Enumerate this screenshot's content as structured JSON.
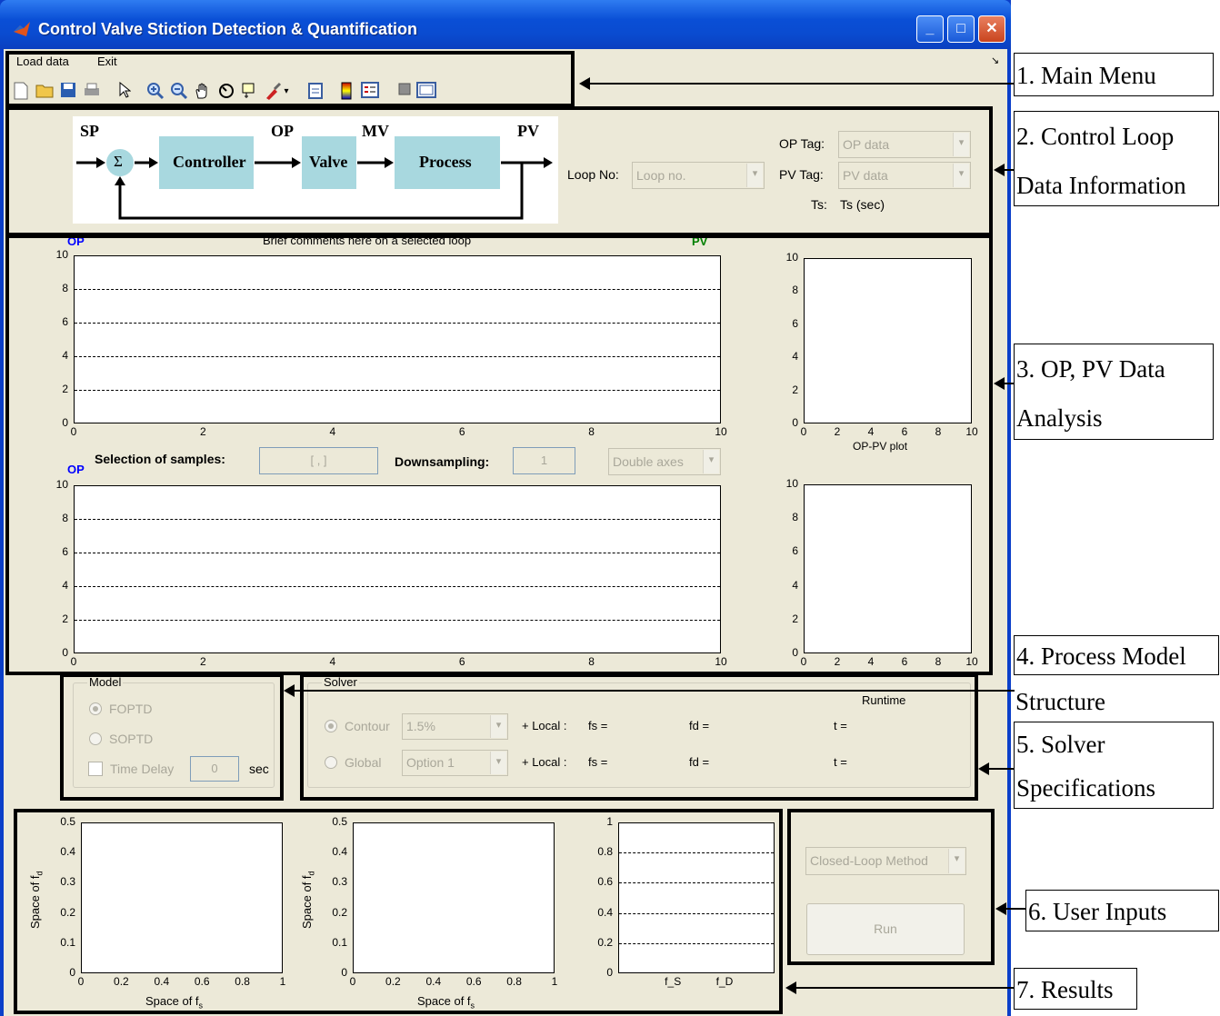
{
  "window": {
    "title": "Control Valve Stiction Detection & Quantification",
    "minimize": "_",
    "maximize": "□",
    "close": "✕"
  },
  "menu": {
    "load_data": "Load data",
    "exit": "Exit",
    "corner": "↘"
  },
  "diagram": {
    "sp": "SP",
    "op": "OP",
    "mv": "MV",
    "pv": "PV",
    "sum": "Σ",
    "controller": "Controller",
    "valve": "Valve",
    "process": "Process"
  },
  "loop_info": {
    "loop_no_label": "Loop No:",
    "loop_no_placeholder": "Loop no.",
    "op_tag_label": "OP Tag:",
    "op_tag_value": "OP data",
    "pv_tag_label": "PV Tag:",
    "pv_tag_value": "PV data",
    "ts_label": "Ts:",
    "ts_value": "Ts (sec)"
  },
  "analysis": {
    "comment": "Brief comments here on a selected loop",
    "top_left_label": "OP",
    "top_right_label": "PV",
    "mid_label": "OP",
    "selection_label": "Selection of samples:",
    "selection_value": "[ , ]",
    "downsampling_label": "Downsampling:",
    "downsampling_value": "1",
    "axes_mode": "Double axes",
    "oppv_xlabel": "OP-PV plot",
    "x_ticks": [
      "0",
      "2",
      "4",
      "6",
      "8",
      "10"
    ],
    "y_ticks": [
      "10",
      "8",
      "6",
      "4",
      "2",
      "0"
    ]
  },
  "model": {
    "title": "Model",
    "foptd": "FOPTD",
    "soptd": "SOPTD",
    "time_delay": "Time Delay",
    "time_delay_value": "0",
    "unit": "sec"
  },
  "solver": {
    "title": "Solver",
    "runtime": "Runtime",
    "contour": "Contour",
    "contour_value": "1.5%",
    "global": "Global",
    "global_value": "Option 1",
    "local": "+ Local :",
    "fs": "fs =",
    "fd": "fd =",
    "t": "t ="
  },
  "user_inputs": {
    "method": "Closed-Loop Method",
    "run": "Run"
  },
  "results": {
    "y_ticks": [
      "0.5",
      "0.4",
      "0.3",
      "0.2",
      "0.1",
      "0"
    ],
    "x_ticks": [
      "0",
      "0.2",
      "0.4",
      "0.6",
      "0.8",
      "1"
    ],
    "ylabel": "Space of f",
    "ylabel_sub": "d",
    "xlabel": "Space of f",
    "xlabel_sub": "s",
    "bar_y_ticks": [
      "1",
      "0.8",
      "0.6",
      "0.4",
      "0.2",
      "0"
    ],
    "bar_x_ticks": [
      "f_S",
      "f_D"
    ]
  },
  "annotations": {
    "a1": "1. Main Menu",
    "a2a": "2. Control Loop",
    "a2b": "Data Information",
    "a3a": "3. OP, PV Data",
    "a3b": "Analysis",
    "a4a": "4. Process Model",
    "a4b": "Structure",
    "a5a": "5. Solver",
    "a5b": "Specifications",
    "a6": "6. User Inputs",
    "a7": "7. Results"
  }
}
